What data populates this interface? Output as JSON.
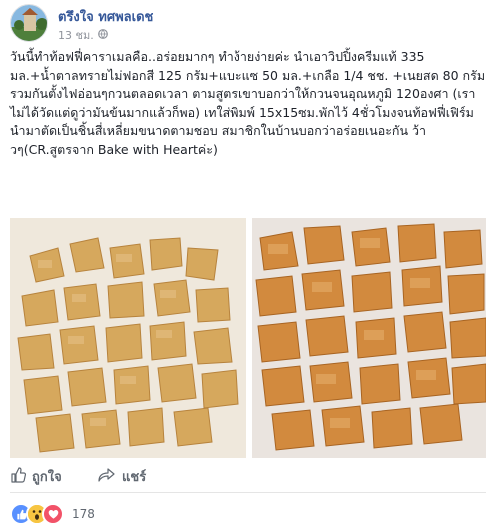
{
  "post": {
    "author": "ตรึงใจ ทศพลเดช",
    "time": "13 ชม.",
    "caption": "วันนี้ทำท้อฟฟี่คาราเมลคือ..อร่อยมากๆ ทำง้ายง่ายค่ะ นำเอาวิปปิ้งครีมแท้ 335 มล.+น้ำตาลทรายไม่ฟอกสี 125 กรัม+แบะแซ 50 มล.+เกลือ 1/4 ชช. +เนยสด 80 กรัม รวมกันตั้งไฟอ่อนๆกวนตลอดเวลา ตามสูตรเขาบอกว่าให้กวนจนอุณหภูมิ 120องศา (เราไม่ได้วัดแต่ดูว่ามันข้นมากแล้วก็พอ) เทใส่พิมพ์ 15x15ซม.พักไว้ 4ชั่วโมงจนท้อฟฟี่เฟิร์ม นำมาตัดเป็นชิ้นสี่เหลี่ยมขนาดตามชอบ สมาชิกในบ้านบอกว่าอร่อยเนอะกัน ว้าวๆ(CR.สูตรจาก Bake with Heartค่ะ)"
  },
  "actions": {
    "like": "ถูกใจ",
    "share": "แชร์"
  },
  "reactions": {
    "count": "178",
    "types": [
      "like-icon",
      "wow-icon",
      "love-icon"
    ]
  },
  "colors": {
    "facebook_blue": "#365899",
    "like_blue": "#5890ff",
    "love_red": "#f25268",
    "wow_yellow": "#f7c542"
  }
}
